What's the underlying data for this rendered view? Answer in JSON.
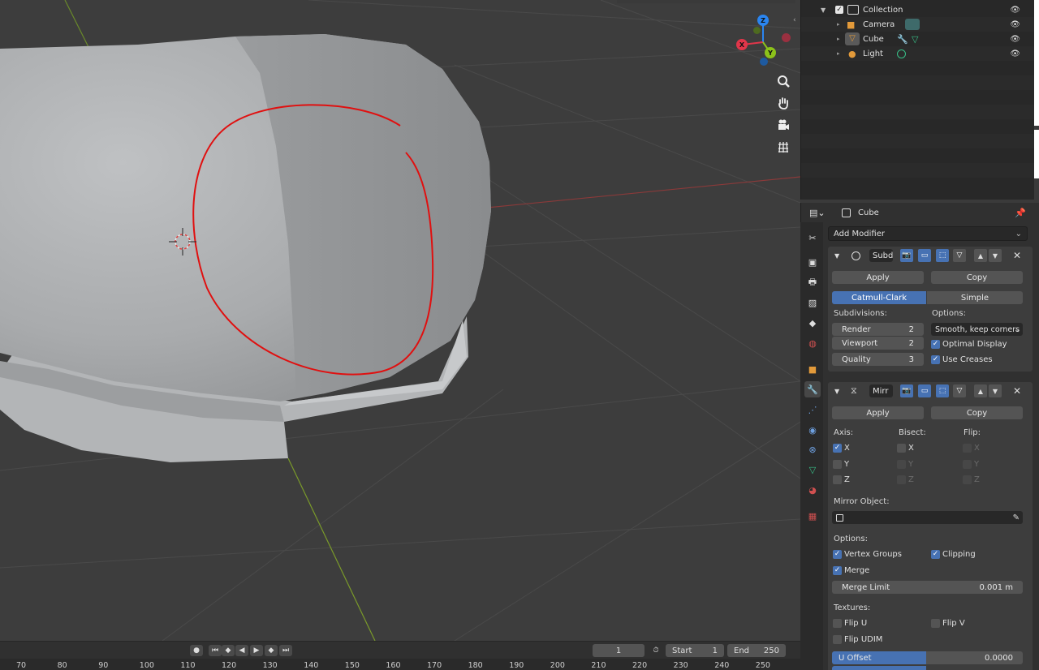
{
  "outliner": {
    "rows": [
      {
        "label": "Collection",
        "icon": "collection-icon"
      },
      {
        "label": "Camera",
        "icon": "camera-icon"
      },
      {
        "label": "Cube",
        "icon": "mesh-icon"
      },
      {
        "label": "Light",
        "icon": "light-icon"
      }
    ]
  },
  "properties": {
    "object_name": "Cube",
    "add_modifier": "Add Modifier",
    "subsurf": {
      "name": "Subd",
      "apply": "Apply",
      "copy": "Copy",
      "type_options": [
        "Catmull-Clark",
        "Simple"
      ],
      "subdivisions_label": "Subdivisions:",
      "options_label": "Options:",
      "render_label": "Render",
      "render_value": "2",
      "viewport_label": "Viewport",
      "viewport_value": "2",
      "quality_label": "Quality",
      "quality_value": "3",
      "uv_smooth": "Smooth, keep corners",
      "optimal_display": "Optimal Display",
      "use_creases": "Use Creases"
    },
    "mirror": {
      "name": "Mirr",
      "apply": "Apply",
      "copy": "Copy",
      "axis_label": "Axis:",
      "bisect_label": "Bisect:",
      "flip_label": "Flip:",
      "x": "X",
      "y": "Y",
      "z": "Z",
      "mirror_object_label": "Mirror Object:",
      "options_label": "Options:",
      "vertex_groups": "Vertex Groups",
      "clipping": "Clipping",
      "merge": "Merge",
      "merge_limit_label": "Merge Limit",
      "merge_limit_value": "0.001 m",
      "textures_label": "Textures:",
      "flip_u": "Flip U",
      "flip_v": "Flip V",
      "flip_udim": "Flip UDIM",
      "u_offset_label": "U Offset",
      "u_offset_value": "0.0000"
    }
  },
  "timeline": {
    "current_frame": "1",
    "start_label": "Start",
    "start_value": "1",
    "end_label": "End",
    "end_value": "250",
    "ticks": [
      "70",
      "80",
      "90",
      "100",
      "110",
      "120",
      "130",
      "140",
      "150",
      "160",
      "170",
      "180",
      "190",
      "200",
      "210",
      "220",
      "230",
      "240",
      "250"
    ]
  },
  "gizmo": {
    "x": "X",
    "y": "Y",
    "z": "Z"
  },
  "colors": {
    "accent": "#4772b3",
    "annotation": "#e01010",
    "x_axis": "#e0364a",
    "y_axis": "#8cc21a",
    "z_axis": "#2a85f0"
  }
}
